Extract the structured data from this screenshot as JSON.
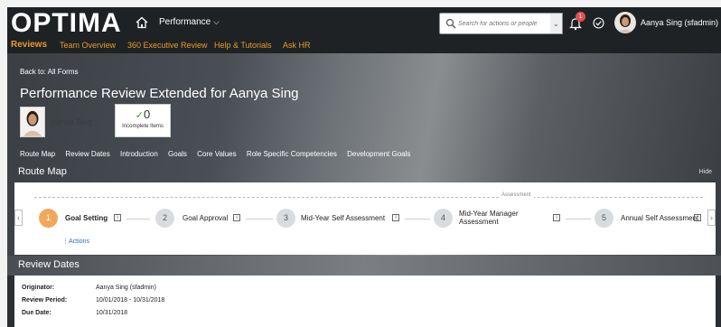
{
  "header": {
    "logo": "OPTIMA",
    "module": "Performance",
    "module_chevron": "⌵",
    "search_placeholder": "Search for actions or people",
    "notification_count": "1",
    "user_name": "Aanya Sing (sfadmin)"
  },
  "nav": {
    "items": [
      {
        "label": "Reviews",
        "active": true
      },
      {
        "label": "Team Overview"
      },
      {
        "label": "360 Executive Review"
      },
      {
        "label": "Help & Tutorials"
      },
      {
        "label": "Ask HR"
      }
    ]
  },
  "form": {
    "back_link": "Back to: All Forms",
    "title": "Performance Review Extended for Aanya Sing",
    "subject_name": "Aanya Sing",
    "incomplete_count": "0",
    "incomplete_label": "Incomplete Items"
  },
  "section_tabs": [
    "Route Map",
    "Review Dates",
    "Introduction",
    "Goals",
    "Core Values",
    "Role Specific Competencies",
    "Development Goals"
  ],
  "route_map": {
    "title": "Route Map",
    "hide_label": "Hide",
    "assessment_label": "Assessment",
    "steps": [
      {
        "num": "1",
        "label": "Goal Setting",
        "active": true
      },
      {
        "num": "2",
        "label": "Goal Approval"
      },
      {
        "num": "3",
        "label": "Mid-Year Self Assessment"
      },
      {
        "num": "4",
        "label": "Mid-Year Manager Assessment"
      },
      {
        "num": "5",
        "label": "Annual Self Assessment"
      }
    ],
    "actions_label": "Actions"
  },
  "review_dates": {
    "title": "Review Dates",
    "rows": [
      {
        "key": "Originator:",
        "value": "Aanya Sing (sfadmin)"
      },
      {
        "key": "Review Period:",
        "value": "10/01/2018 - 10/31/2018"
      },
      {
        "key": "Due Date:",
        "value": "10/31/2018"
      }
    ]
  },
  "colors": {
    "accent": "#e89b26",
    "active_step": "#f0a95c",
    "link": "#2a6bb3",
    "badge": "#e05050"
  }
}
